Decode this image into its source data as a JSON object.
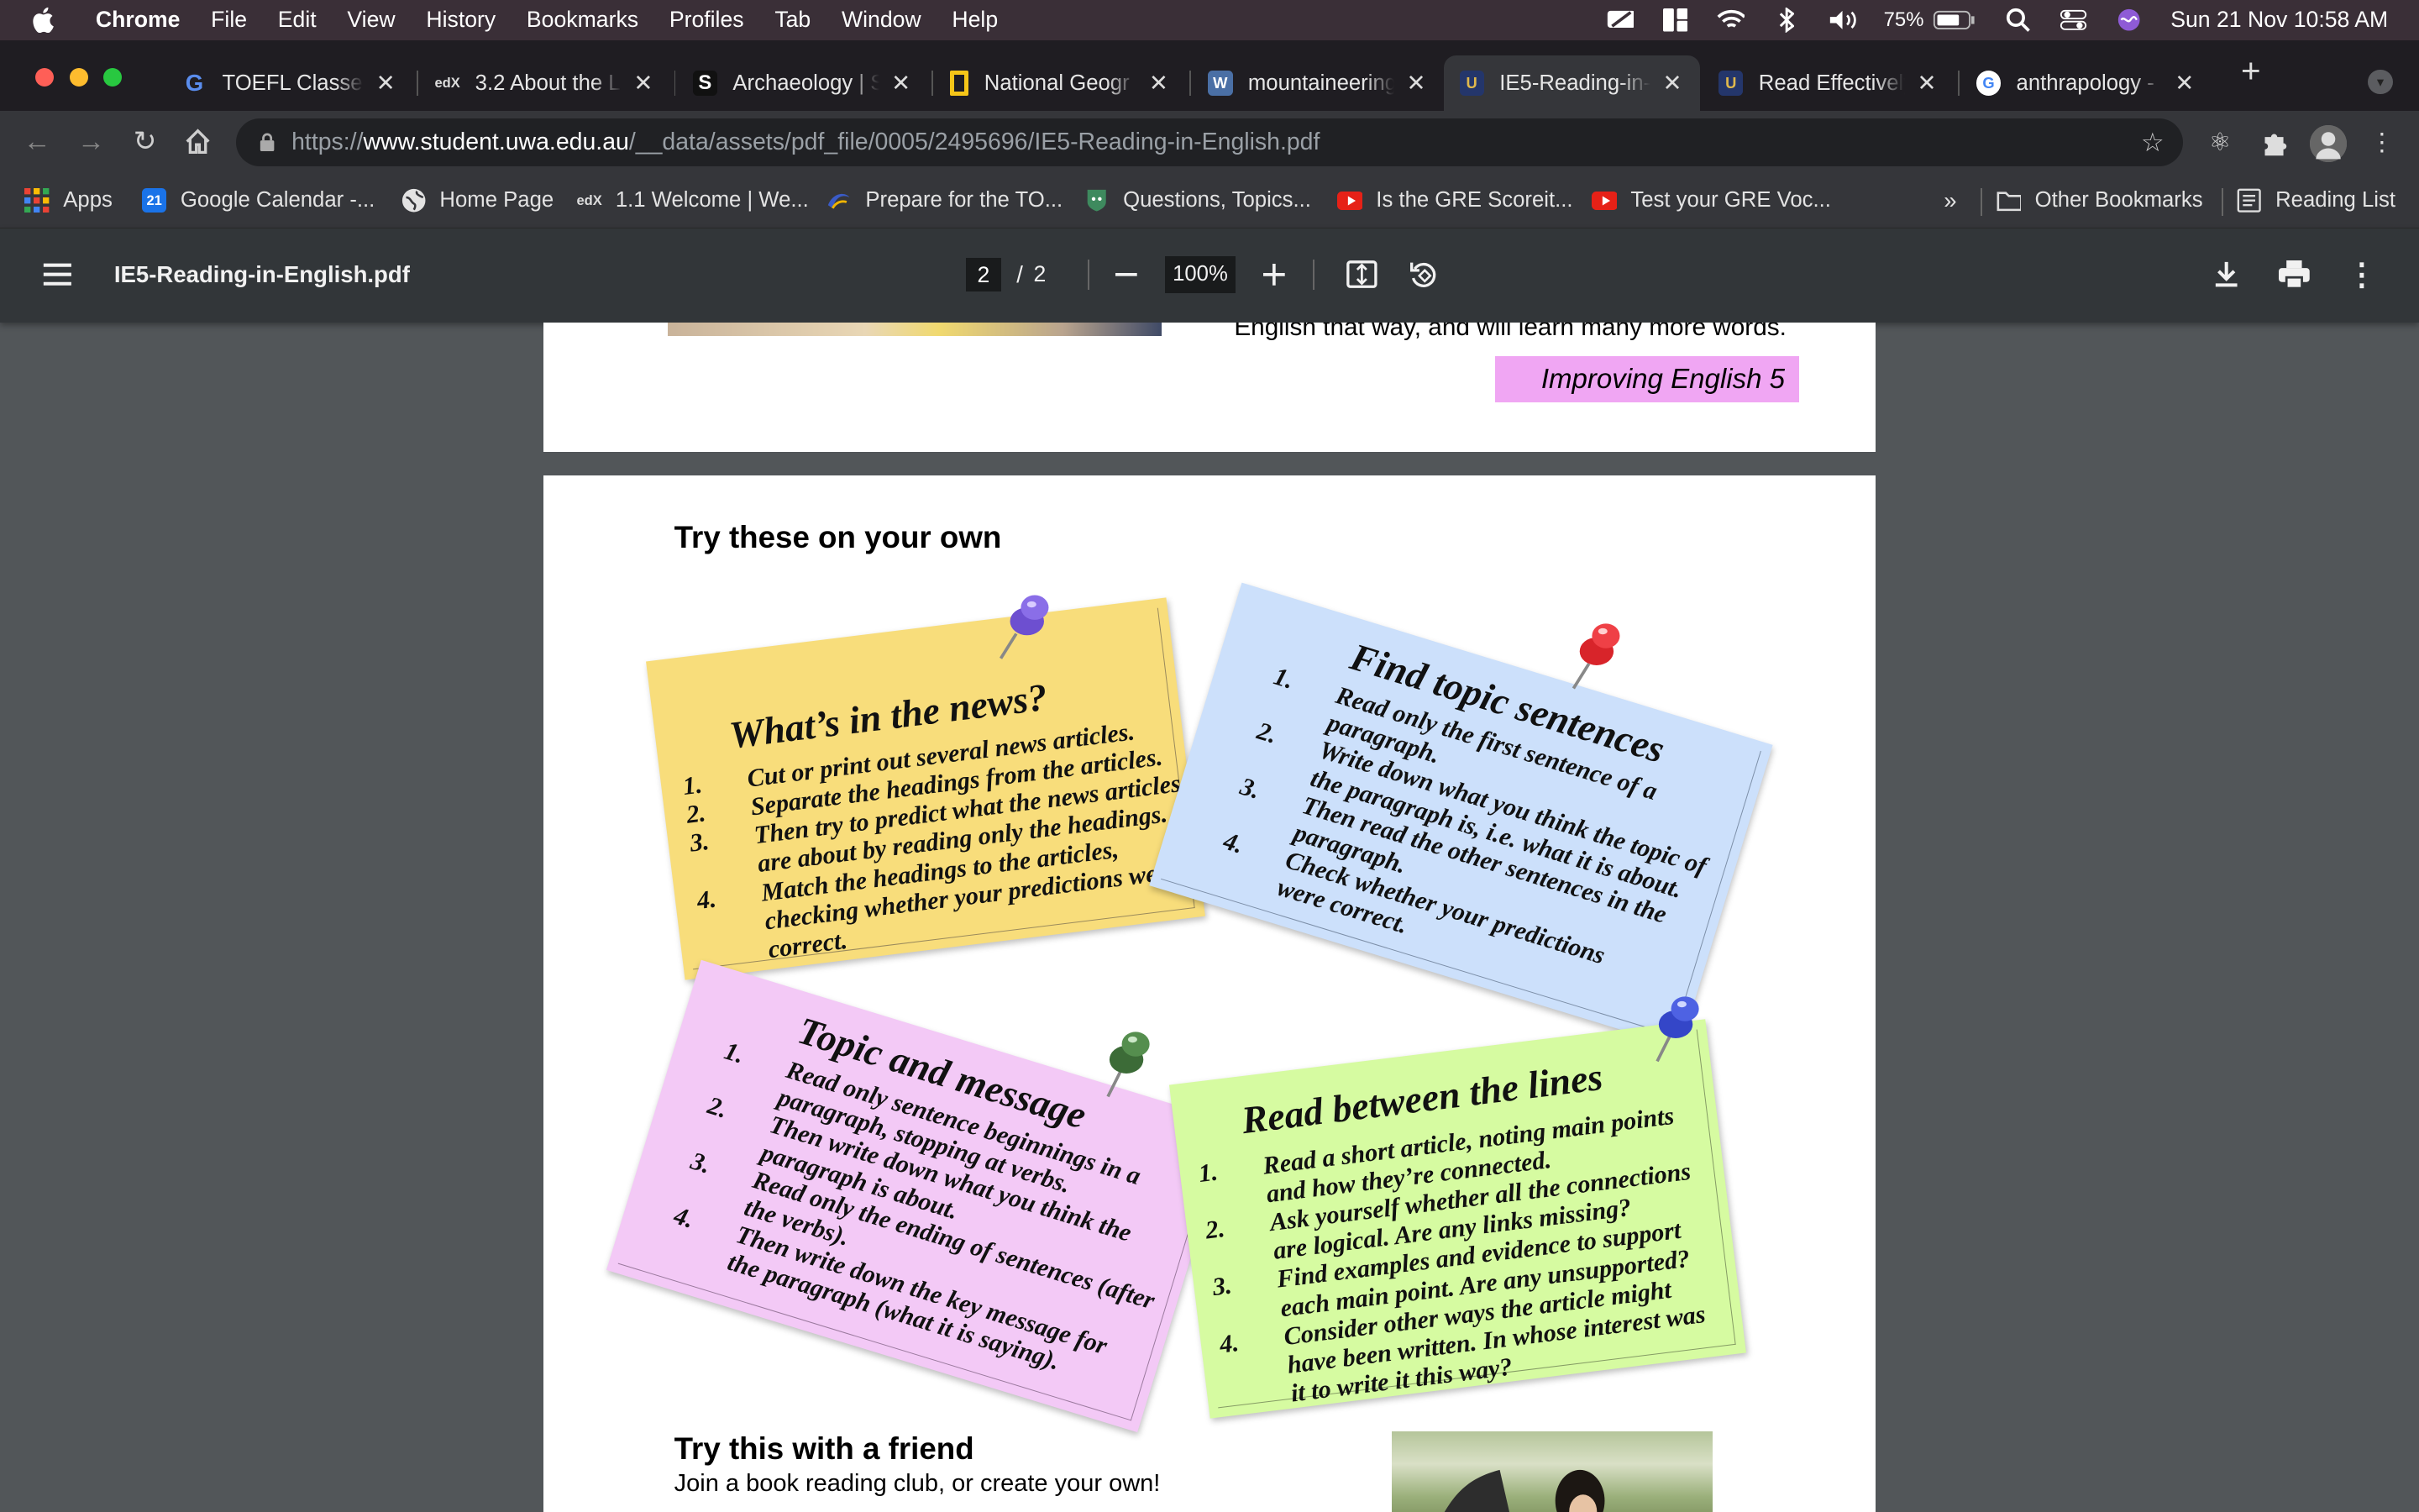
{
  "menubar": {
    "app": "Chrome",
    "items": [
      "File",
      "Edit",
      "View",
      "History",
      "Bookmarks",
      "Profiles",
      "Tab",
      "Window",
      "Help"
    ],
    "battery": "75%",
    "datetime": "Sun 21 Nov  10:58 AM"
  },
  "tabs": [
    {
      "title": "TOEFL Classes",
      "icon": "G",
      "color": "#1f1d22",
      "fg": "#5a8dee"
    },
    {
      "title": "3.2 About the L",
      "icon": "edX",
      "color": "#1f1d22",
      "fg": "#ddd"
    },
    {
      "title": "Archaeology | S",
      "icon": "S",
      "color": "#111",
      "fg": "#fff"
    },
    {
      "title": "National Geogr",
      "icon": "",
      "color": "#f5c518",
      "fg": "#000"
    },
    {
      "title": "mountaineering",
      "icon": "W",
      "color": "#4a6fa5",
      "fg": "#fff"
    },
    {
      "title": "IE5-Reading-in-",
      "icon": "U",
      "color": "#24366b",
      "fg": "#e0b84c"
    },
    {
      "title": "Read Effectively",
      "icon": "U",
      "color": "#24366b",
      "fg": "#e0b84c"
    },
    {
      "title": "anthrapology -",
      "icon": "G",
      "color": "#fff",
      "fg": "#4285f4"
    }
  ],
  "url": {
    "prefix": "https://",
    "host": "www.student.uwa.edu.au",
    "path": "/__data/assets/pdf_file/0005/2495696/IE5-Reading-in-English.pdf"
  },
  "bookmarks": [
    {
      "label": "Apps",
      "icon": "grid",
      "color": "#ea4335"
    },
    {
      "label": "Google Calendar -...",
      "icon": "21",
      "color": "#1a73e8"
    },
    {
      "label": "Home Page",
      "icon": "globe",
      "color": "#e3e3e3"
    },
    {
      "label": "1.1 Welcome | We...",
      "icon": "edX",
      "color": "#35363a"
    },
    {
      "label": "Prepare for the TO...",
      "icon": "ets",
      "color": "#2b4d9c"
    },
    {
      "label": "Questions, Topics...",
      "icon": "q",
      "color": "#3e8a5e"
    },
    {
      "label": "Is the GRE Scoreit...",
      "icon": "yt",
      "color": "#e62117"
    },
    {
      "label": "Test your GRE Voc...",
      "icon": "yt",
      "color": "#e62117"
    }
  ],
  "bookmarks_right": {
    "more": "»",
    "other": "Other Bookmarks",
    "reading": "Reading List"
  },
  "pdf": {
    "filename": "IE5-Reading-in-English.pdf",
    "current_page": "2",
    "separator": "/",
    "total_pages": "2",
    "zoom": "100%"
  },
  "page1": {
    "text_line": "English that way, and will learn many more words.",
    "badge": "Improving English 5"
  },
  "page2": {
    "heading": "Try these on your own",
    "notes": [
      {
        "title": "What’s in the news?",
        "color": "#f8dd7b",
        "items": [
          {
            "num": "1.",
            "lines": [
              "Cut or print out several news articles."
            ]
          },
          {
            "num": "2.",
            "lines": [
              "Separate the headings from the articles."
            ]
          },
          {
            "num": "3.",
            "lines": [
              "Then try to predict what the news articles",
              "are about by reading only the headings."
            ]
          },
          {
            "num": "4.",
            "lines": [
              "Match the headings to the articles,",
              "checking whether your predictions were",
              "correct."
            ]
          }
        ]
      },
      {
        "title": "Find topic sentences",
        "color": "#cce0fb",
        "items": [
          {
            "num": "1.",
            "lines": [
              "Read only the first sentence of a",
              "paragraph."
            ]
          },
          {
            "num": "2.",
            "lines": [
              "Write down what you think the topic of",
              "the paragraph is, i.e. what it is about."
            ]
          },
          {
            "num": "3.",
            "lines": [
              "Then read the other sentences in the",
              "paragraph."
            ]
          },
          {
            "num": "4.",
            "lines": [
              "Check whether your predictions",
              "were correct."
            ]
          }
        ]
      },
      {
        "title": "Topic and message",
        "color": "#f3c9f6",
        "items": [
          {
            "num": "1.",
            "lines": [
              "Read only sentence beginnings in a",
              "paragraph, stopping at verbs."
            ]
          },
          {
            "num": "2.",
            "lines": [
              "Then write down what you think the",
              "paragraph is about."
            ]
          },
          {
            "num": "3.",
            "lines": [
              "Read only the ending of sentences (after",
              "the verbs)."
            ]
          },
          {
            "num": "4.",
            "lines": [
              "Then write down the key message for",
              "the paragraph (what it is saying)."
            ]
          }
        ]
      },
      {
        "title": "Read between the lines",
        "color": "#d6fba1",
        "items": [
          {
            "num": "1.",
            "lines": [
              "Read a short article, noting main points",
              "and how they’re connected."
            ]
          },
          {
            "num": "2.",
            "lines": [
              "Ask yourself whether all the connections",
              "are logical. Are any links missing?"
            ]
          },
          {
            "num": "3.",
            "lines": [
              "Find examples and evidence to support",
              "each main point. Are any unsupported?"
            ]
          },
          {
            "num": "4.",
            "lines": [
              "Consider other ways the article might",
              "have been written. In whose interest was",
              "it to write it this way?"
            ]
          }
        ]
      }
    ],
    "friend_heading": "Try this with a friend",
    "friend_text": "Join a book reading club, or create your own!"
  },
  "pins": {
    "purple": "#6d4fd0",
    "red": "#d8242a",
    "green": "#3c6b37",
    "blue": "#3446c8"
  }
}
